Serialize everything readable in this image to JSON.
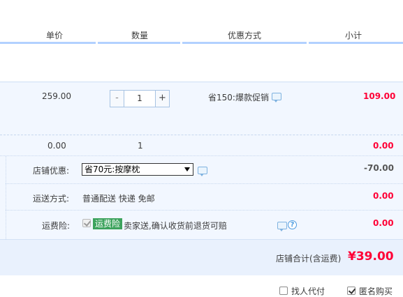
{
  "header": {
    "col_unit_price": "单价",
    "col_quantity": "数量",
    "col_discount": "优惠方式",
    "col_subtotal": "小计"
  },
  "item": {
    "unit_price": "259.00",
    "quantity": "1",
    "minus": "-",
    "plus": "+",
    "discount": "省150:爆款促销",
    "subtotal": "109.00"
  },
  "item2": {
    "unit_price": "0.00",
    "quantity": "1",
    "subtotal": "0.00"
  },
  "shop_discount": {
    "label": "店铺优惠:",
    "selected": "省70元:按摩枕",
    "amount": "-70.00"
  },
  "shipping": {
    "label": "运送方式:",
    "value": "普通配送 快递 免邮",
    "amount": "0.00"
  },
  "insurance": {
    "label": "运费险:",
    "tag": "运费险",
    "text": "卖家送,确认收货前退货可赔",
    "help": "?",
    "amount": "0.00"
  },
  "total": {
    "label": "店铺合计(含运费)",
    "amount": "¥39.00"
  },
  "footer": {
    "pay_for_others": "找人代付",
    "anonymous": "匿名购买"
  },
  "colors": {
    "accent_red": "#ff0036",
    "header_line": "#b2d1ff",
    "row_bg": "#f2f7ff",
    "tag_green": "#3da35d"
  }
}
